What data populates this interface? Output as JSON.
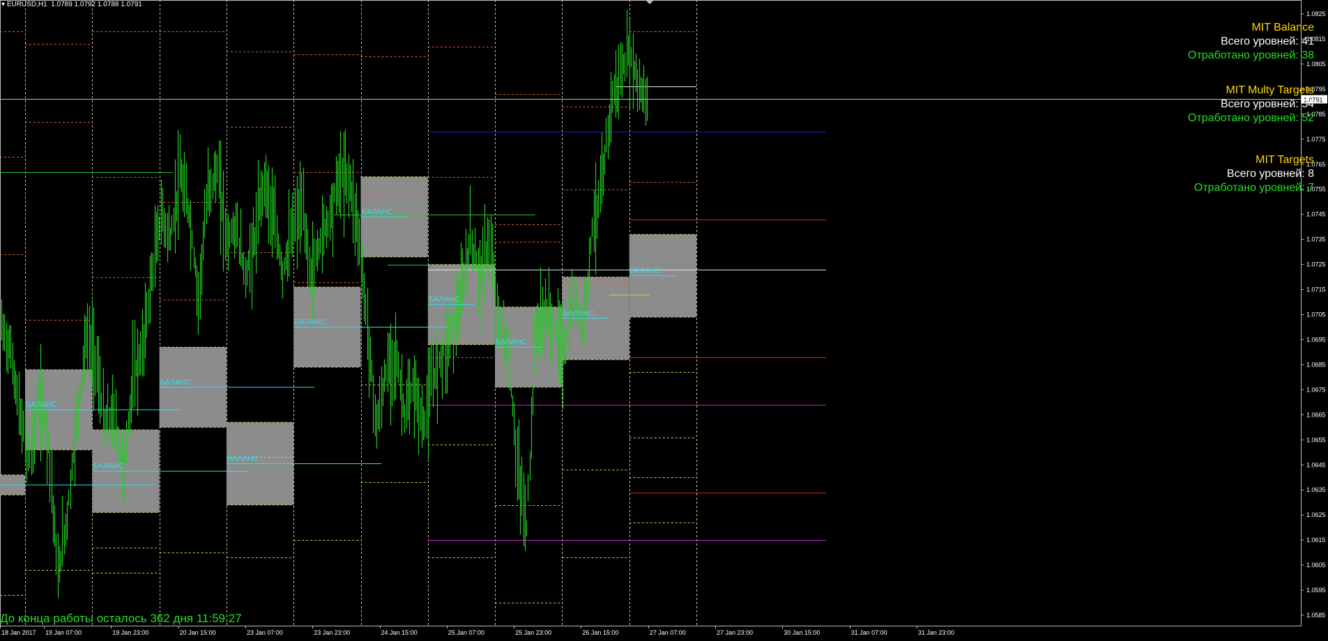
{
  "header": {
    "symbol": "EURUSD,H1",
    "ohlc": "1.0789 1.0792 1.0788 1.0791"
  },
  "panels": [
    {
      "title": "MIT Balance",
      "levels_label": "Всего уровней: 41",
      "worked_label": "Отработано уровней: 38"
    },
    {
      "title": "MIT Multy Targets",
      "levels_label": "Всего уровней: 54",
      "worked_label": "Отработано уровней: 52"
    },
    {
      "title": "MIT Targets",
      "levels_label": "Всего уровней: 8",
      "worked_label": "Отработано уровней: 7"
    }
  ],
  "countdown": "До конца работы осталось 362 дня 11:59:27",
  "colors": {
    "background": "#000000",
    "candles": "#22CC22",
    "balance_box": "#8C8C8C",
    "balance_label": "#33DDEE",
    "current_price": "#B0C4DE",
    "panel_title": "#FFD700"
  },
  "chart_data": {
    "type": "bar",
    "symbol": "EURUSD",
    "timeframe": "H1",
    "current_price": 1.0791,
    "y_range": [
      1.0585,
      1.0825
    ],
    "y_ticks": [
      "1.0825",
      "1.0815",
      "1.0805",
      "1.0795",
      "1.0785",
      "1.0775",
      "1.0765",
      "1.0755",
      "1.0745",
      "1.0735",
      "1.0725",
      "1.0715",
      "1.0705",
      "1.0695",
      "1.0685",
      "1.0675",
      "1.0665",
      "1.0655",
      "1.0645",
      "1.0635",
      "1.0625",
      "1.0615",
      "1.0605",
      "1.0595",
      "1.0585"
    ],
    "x_labels": [
      "18 Jan 2017",
      "19 Jan 07:00",
      "19 Jan 23:00",
      "20 Jan 15:00",
      "23 Jan 07:00",
      "23 Jan 23:00",
      "24 Jan 15:00",
      "25 Jan 07:00",
      "25 Jan 23:00",
      "26 Jan 15:00",
      "27 Jan 07:00",
      "27 Jan 23:00",
      "30 Jan 15:00",
      "31 Jan 07:00",
      "31 Jan 23:00"
    ],
    "balance_label": "БАЛАНС",
    "balance_zones": [
      {
        "period": 0,
        "low": 1.0633,
        "high": 1.0641,
        "label": false
      },
      {
        "period": 1,
        "low": 1.0651,
        "high": 1.0683,
        "label": true
      },
      {
        "period": 2,
        "low": 1.0626,
        "high": 1.0659,
        "label": true
      },
      {
        "period": 3,
        "low": 1.066,
        "high": 1.0692,
        "label": true
      },
      {
        "period": 4,
        "low": 1.0629,
        "high": 1.0662,
        "label": true
      },
      {
        "period": 5,
        "low": 1.0684,
        "high": 1.0716,
        "label": true
      },
      {
        "period": 6,
        "low": 1.0728,
        "high": 1.076,
        "label": true
      },
      {
        "period": 7,
        "low": 1.0693,
        "high": 1.0725,
        "label": true
      },
      {
        "period": 8,
        "low": 1.0676,
        "high": 1.0708,
        "label": true
      },
      {
        "period": 9,
        "low": 1.0687,
        "high": 1.072,
        "label": true
      },
      {
        "period": 10,
        "low": 1.0704,
        "high": 1.0737,
        "label": true
      }
    ],
    "price_path": [
      1.07,
      1.069,
      1.0663,
      1.0648,
      1.0672,
      1.0655,
      1.06,
      1.0625,
      1.0663,
      1.0695,
      1.0688,
      1.066,
      1.0665,
      1.0642,
      1.068,
      1.069,
      1.072,
      1.0745,
      1.0735,
      1.076,
      1.0745,
      1.0712,
      1.0755,
      1.0762,
      1.0735,
      1.074,
      1.072,
      1.0735,
      1.076,
      1.0742,
      1.0722,
      1.0738,
      1.0748,
      1.072,
      1.0735,
      1.0745,
      1.076,
      1.076,
      1.074,
      1.07,
      1.066,
      1.0682,
      1.069,
      1.0665,
      1.0676,
      1.066,
      1.068,
      1.069,
      1.07,
      1.071,
      1.0736,
      1.072,
      1.0735,
      1.07,
      1.069,
      1.0645,
      1.062,
      1.07,
      1.0705,
      1.07,
      1.069,
      1.0712,
      1.07,
      1.074,
      1.0755,
      1.079,
      1.08,
      1.081,
      1.0795,
      1.079
    ]
  }
}
